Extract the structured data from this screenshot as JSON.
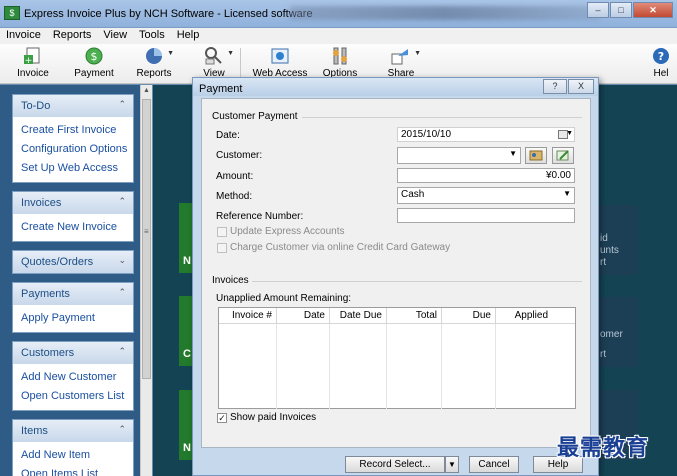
{
  "window": {
    "title": "Express Invoice Plus by NCH Software - Licensed software"
  },
  "menubar": [
    "Invoice",
    "Reports",
    "View",
    "Tools",
    "Help"
  ],
  "toolbar": [
    {
      "label": "Invoice",
      "icon": "new-invoice-icon"
    },
    {
      "label": "Payment",
      "icon": "payment-icon"
    },
    {
      "label": "Reports",
      "icon": "reports-icon"
    },
    {
      "label": "View",
      "icon": "view-icon"
    },
    {
      "label": "Web Access",
      "icon": "web-access-icon"
    },
    {
      "label": "Options",
      "icon": "options-icon"
    },
    {
      "label": "Share",
      "icon": "share-icon"
    },
    {
      "label": "Hel",
      "icon": "help-icon"
    }
  ],
  "sidebar": {
    "todo": {
      "title": "To-Do",
      "links": [
        "Create First Invoice",
        "Configuration Options",
        "Set Up Web Access"
      ]
    },
    "invoices": {
      "title": "Invoices",
      "links": [
        "Create New Invoice"
      ]
    },
    "quotes": {
      "title": "Quotes/Orders"
    },
    "payments": {
      "title": "Payments",
      "links": [
        "Apply Payment"
      ]
    },
    "customers": {
      "title": "Customers",
      "links": [
        "Add New Customer",
        "Open Customers List"
      ]
    },
    "items": {
      "title": "Items",
      "links": [
        "Add New Item",
        "Open Items List"
      ]
    }
  },
  "background": {
    "tile_texts": [
      "id",
      "unts",
      "rt",
      "omer",
      "rt"
    ],
    "green_tile_texts": [
      "N",
      "C",
      "N"
    ]
  },
  "dialog": {
    "title": "Payment",
    "help_btn": "?",
    "close_btn": "X",
    "customer_payment": {
      "group_title": "Customer Payment",
      "date_label": "Date:",
      "date_value": "2015/10/10",
      "customer_label": "Customer:",
      "customer_value": "",
      "amount_label": "Amount:",
      "amount_value": "¥0.00",
      "method_label": "Method:",
      "method_value": "Cash",
      "reference_label": "Reference Number:",
      "reference_value": "",
      "update_accounts_label": "Update Express Accounts",
      "charge_label": "Charge Customer via online Credit Card Gateway"
    },
    "invoices": {
      "group_title": "Invoices",
      "unapplied_label": "Unapplied Amount Remaining:",
      "columns": [
        "Invoice #",
        "Date",
        "Date Due",
        "Total",
        "Due",
        "Applied"
      ],
      "show_paid_label": "Show paid Invoices",
      "show_paid_checked": true
    },
    "footer": {
      "record_select": "Record Select...",
      "cancel": "Cancel",
      "help": "Help"
    }
  },
  "watermark": "最需教育"
}
